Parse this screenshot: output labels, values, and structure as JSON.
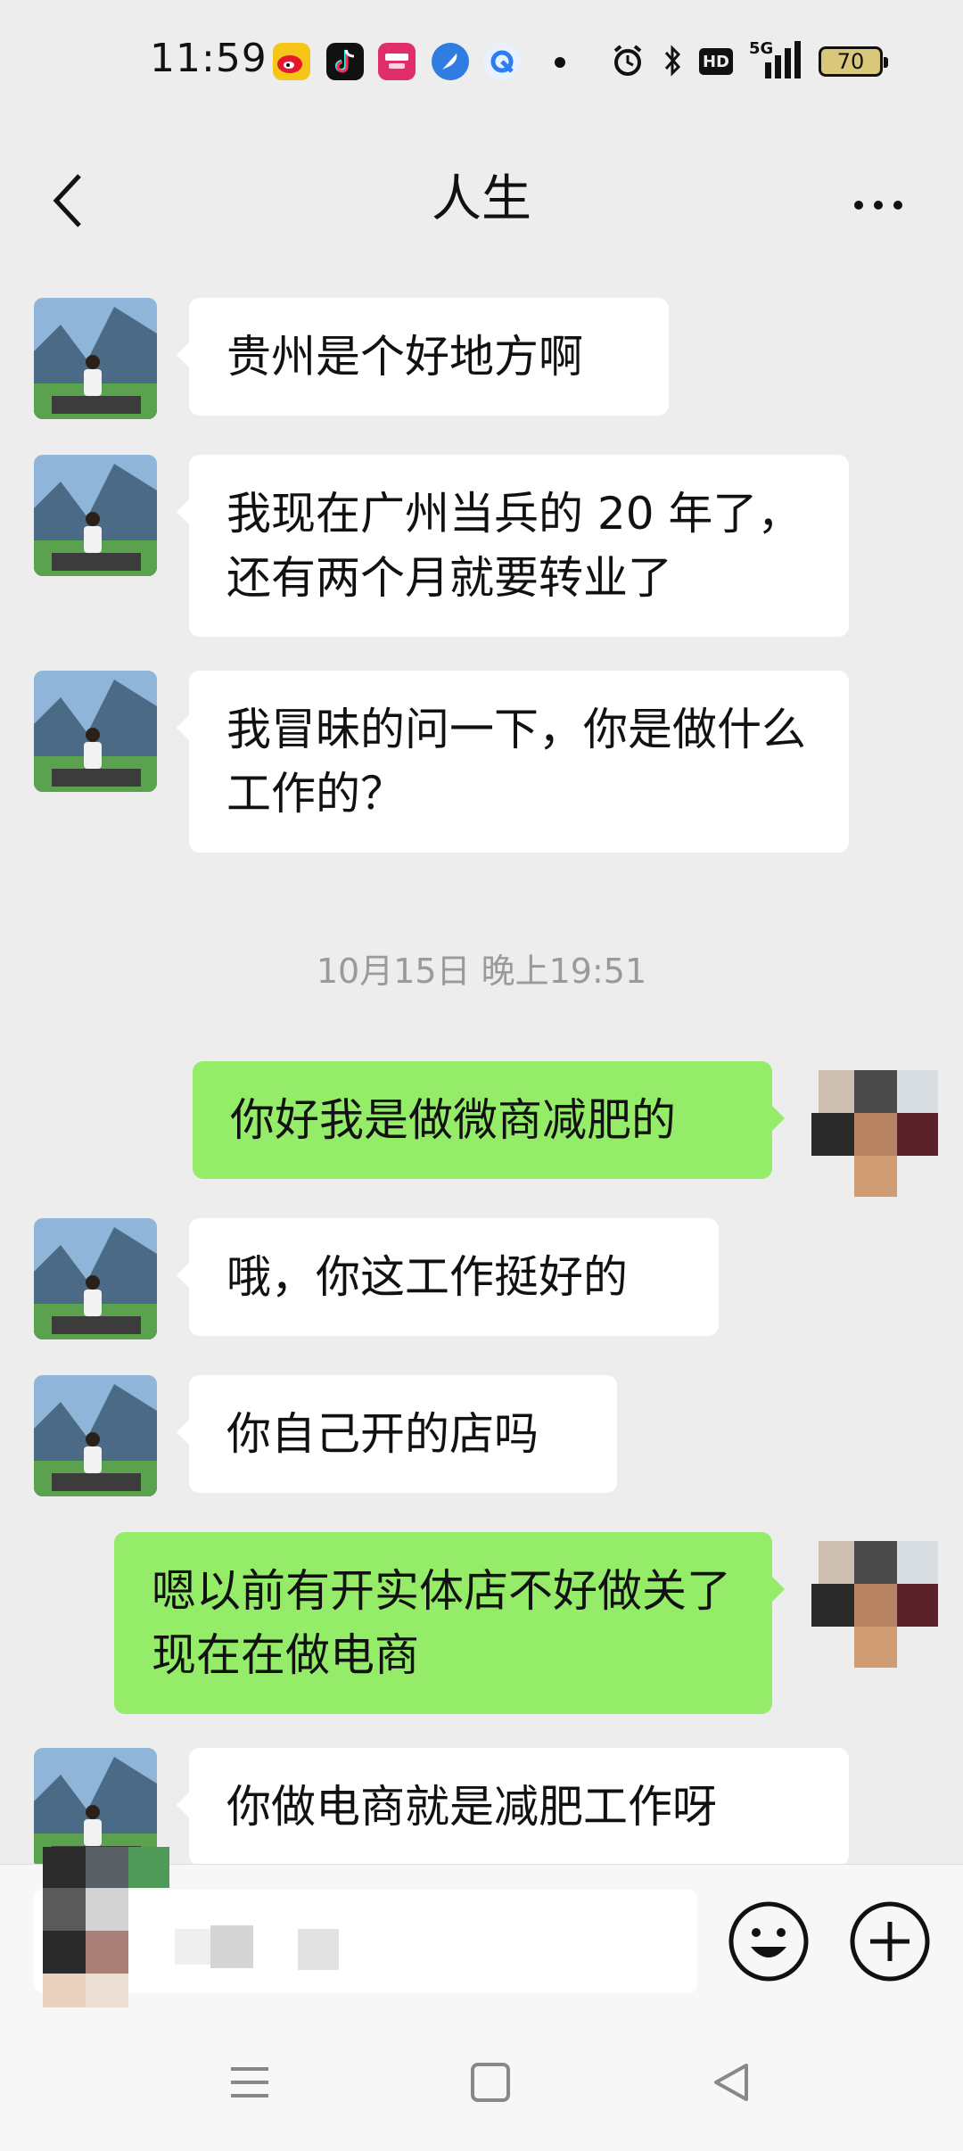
{
  "status_bar": {
    "time": "11:59",
    "app_icons": [
      "weibo-icon",
      "tiktok-icon",
      "pinduoduo-icon",
      "feather-app-icon",
      "browser-icon"
    ],
    "hd_label": "HD",
    "network_label": "5G",
    "battery_level": "70"
  },
  "nav": {
    "title": "人生"
  },
  "messages": [
    {
      "side": "in",
      "text": "贵州是个好地方啊"
    },
    {
      "side": "in",
      "text": "我现在广州当兵的 20 年了，还有两个月就要转业了"
    },
    {
      "side": "in",
      "text": "我冒昧的问一下，你是做什么工作的？"
    },
    {
      "type": "time",
      "text": "10月15日 晚上19:51"
    },
    {
      "side": "out",
      "text": "你好我是做微商减肥的"
    },
    {
      "side": "in",
      "text": "哦，你这工作挺好的"
    },
    {
      "side": "in",
      "text": "你自己开的店吗"
    },
    {
      "side": "out",
      "text": "嗯以前有开实体店不好做关了现在在做电商"
    },
    {
      "side": "in",
      "text": "你做电商就是减肥工作呀"
    }
  ],
  "colors": {
    "background": "#ededed",
    "incoming_bubble": "#ffffff",
    "outgoing_bubble": "#95ec69",
    "timestamp": "#9a9a9a"
  }
}
